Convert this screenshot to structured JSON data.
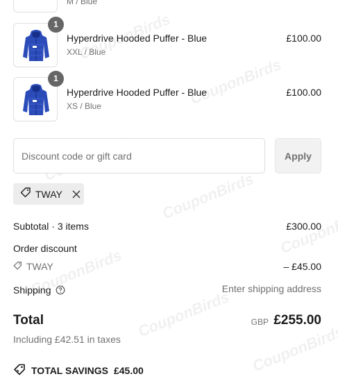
{
  "cart": {
    "partial_item": {
      "variant": "M / Blue"
    },
    "items": [
      {
        "name": "Hyperdrive Hooded Puffer - Blue",
        "variant": "XXL / Blue",
        "price": "£100.00",
        "quantity": "1"
      },
      {
        "name": "Hyperdrive Hooded Puffer - Blue",
        "variant": "XS / Blue",
        "price": "£100.00",
        "quantity": "1"
      }
    ]
  },
  "discount": {
    "placeholder": "Discount code or gift card",
    "value": "",
    "apply_label": "Apply",
    "applied_code": "TWAY"
  },
  "summary": {
    "subtotal_label": "Subtotal · 3 items",
    "subtotal_value": "£300.00",
    "order_discount_label": "Order discount",
    "discount_code": "TWAY",
    "discount_value": "– £45.00",
    "shipping_label": "Shipping",
    "shipping_value": "Enter shipping address",
    "total_label": "Total",
    "currency": "GBP",
    "total_value": "£255.00",
    "tax_note": "Including £42.51 in taxes",
    "savings_label": "TOTAL SAVINGS",
    "savings_value": "£45.00"
  },
  "watermark": "CouponBirds",
  "colors": {
    "product_blue": "#2a4bb8",
    "badge": "#666666",
    "muted": "#707070"
  },
  "icons": {
    "tag": "tag-icon",
    "close": "close-icon",
    "help": "help-circle-icon",
    "savings": "savings-tag-icon"
  }
}
